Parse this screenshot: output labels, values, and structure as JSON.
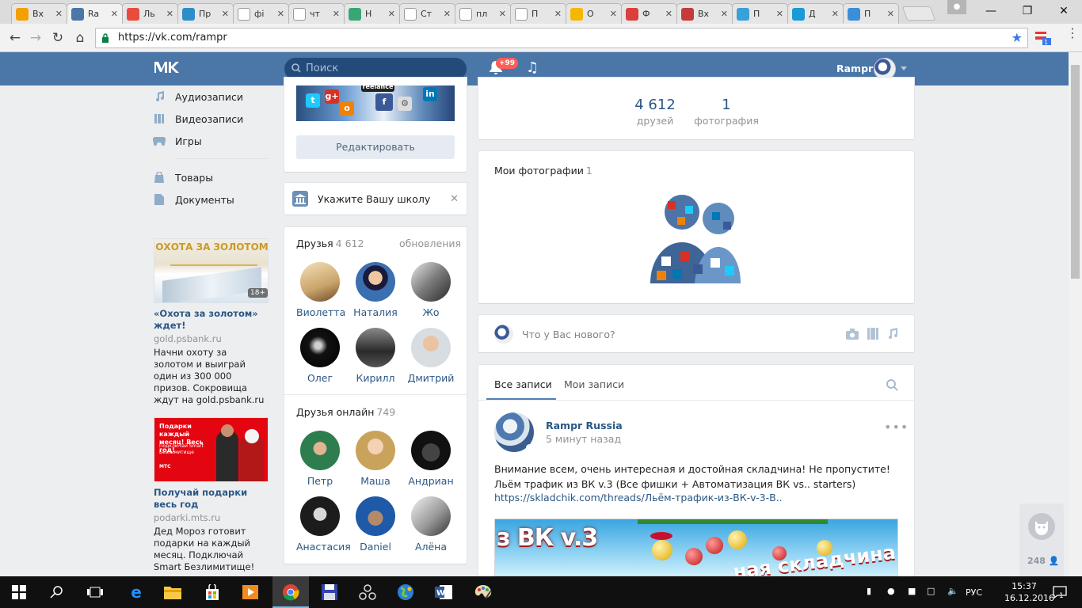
{
  "browser": {
    "tabs": [
      {
        "title": "Вх",
        "favicon": "mail-at-icon",
        "color": "#f2a100"
      },
      {
        "title": "Ra",
        "favicon": "vk-icon",
        "color": "#4a76a8",
        "active": true
      },
      {
        "title": "Ль",
        "favicon": "colorwheel-icon",
        "color": "#e94b3c"
      },
      {
        "title": "Пр",
        "favicon": "ip-icon",
        "color": "#2c8ec9"
      },
      {
        "title": "фі",
        "favicon": "google-icon",
        "color": "#ffffff"
      },
      {
        "title": "чт",
        "favicon": "google-icon",
        "color": "#ffffff"
      },
      {
        "title": "Н",
        "favicon": "leaf-icon",
        "color": "#3aa676"
      },
      {
        "title": "Ст",
        "favicon": "page-icon",
        "color": "#ffffff"
      },
      {
        "title": "пл",
        "favicon": "google-icon",
        "color": "#ffffff"
      },
      {
        "title": "П",
        "favicon": "page-icon",
        "color": "#ffffff"
      },
      {
        "title": "О",
        "favicon": "w-icon",
        "color": "#f5b800"
      },
      {
        "title": "Ф",
        "favicon": "bookmark-icon",
        "color": "#d9403c"
      },
      {
        "title": "Вх",
        "favicon": "arrow-icon",
        "color": "#c63a3a"
      },
      {
        "title": "П",
        "favicon": "p-icon",
        "color": "#3aa0d8"
      },
      {
        "title": "Д",
        "favicon": "play-icon",
        "color": "#1a9ad6"
      },
      {
        "title": "П",
        "favicon": "u-icon",
        "color": "#3a8fd8"
      }
    ],
    "url": "https://vk.com/rampr",
    "ext_badge": "1"
  },
  "vk": {
    "search_placeholder": "Поиск",
    "notif_badge": "+99",
    "user_name": "Rampr",
    "left_nav": [
      {
        "label": "Аудиозаписи",
        "icon": "audio-icon"
      },
      {
        "label": "Видеозаписи",
        "icon": "video-icon"
      },
      {
        "label": "Игры",
        "icon": "gamepad-icon"
      },
      {
        "label": "Товары",
        "icon": "bag-icon"
      },
      {
        "label": "Документы",
        "icon": "document-icon"
      }
    ],
    "ads": [
      {
        "img_text": "ОХОТА ЗА ЗОЛОТОМ",
        "img_age": "18+",
        "title": "«Охота за золотом» ждет!",
        "domain": "gold.psbank.ru",
        "text": "Начни охоту за золотом и выиграй один из 300 000 призов. Сокровища ждут на gold.psbank.ru"
      },
      {
        "img_text": "Подарки каждый месяц! Весь год!",
        "img_sub": "Подключай Smart Безлимитище",
        "img_brand": "МТС",
        "title": "Получай подарки весь год",
        "domain": "podarki.mts.ru",
        "text": "Дед Мороз готовит подарки на каждый месяц. Подключай Smart Безлимитище!"
      }
    ],
    "edit_button": "Редактировать",
    "school_prompt": "Укажите Вашу школу",
    "friends": {
      "title": "Друзья",
      "count": "4 612",
      "updates_link": "обновления",
      "list": [
        "Виолетта",
        "Наталия",
        "Жо",
        "Олег",
        "Кирилл",
        "Дмитрий"
      ]
    },
    "friends_online": {
      "title": "Друзья онлайн",
      "count": "749",
      "list": [
        "Петр",
        "Маша",
        "Андриан",
        "Анастасия",
        "Daniel",
        "Алёна"
      ]
    },
    "stats": [
      {
        "num": "4 612",
        "label": "друзей"
      },
      {
        "num": "1",
        "label": "фотография"
      }
    ],
    "photos": {
      "title": "Мои фотографии",
      "count": "1"
    },
    "composer_placeholder": "Что у Вас нового?",
    "wall_tabs": [
      "Все записи",
      "Мои записи"
    ],
    "post": {
      "author": "Rampr Russia",
      "time": "5 минут назад",
      "line1": "Внимание всем, очень интересная и достойная складчина! Не пропустите!",
      "line2": "Льём трафик из ВК v.3 (Все фишки + Автоматизация ВК vs.. starters)",
      "link": "https://skladchik.com/threads/Льём-трафик-из-ВК-v-3-В..",
      "image_text": "з ВК v.3",
      "image_text2": "ная складчина"
    },
    "widget_count": "248"
  },
  "taskbar": {
    "lang": "РУС",
    "time": "15:37",
    "date": "16.12.2016",
    "notif_count": "1"
  }
}
